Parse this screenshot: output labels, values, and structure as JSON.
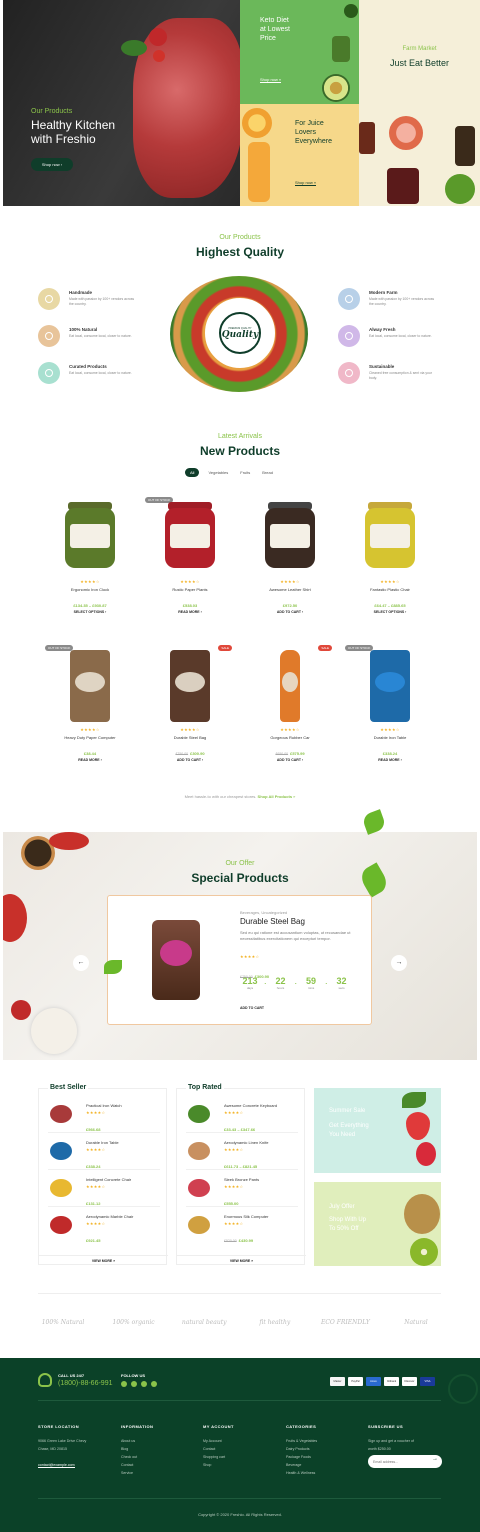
{
  "hero": {
    "main": {
      "kicker": "Our Products",
      "title_l1": "Healthy Kitchen",
      "title_l2": "with Freshio",
      "button": "Shop now"
    },
    "keto": {
      "l1": "Keto Diet",
      "l2": "at Lowest",
      "l3": "Price",
      "button": "Shop now"
    },
    "farm": {
      "kicker": "Farm Market",
      "title": "Just Eat Better"
    },
    "juice": {
      "l1": "For Juice",
      "l2": "Lovers",
      "l3": "Everywhere",
      "button": "Shop now"
    }
  },
  "quality": {
    "kicker": "Our Products",
    "title": "Highest Quality",
    "badge_top": "PREMIUM QUALITY",
    "badge_word": "Quality",
    "left": [
      {
        "title": "Handmade",
        "desc": "Made with passion by 100+ vendors across the country.",
        "icon": "hand-icon",
        "color": "#e8d8a4"
      },
      {
        "title": "100% Natural",
        "desc": "Eat local, consume local, closer to nature.",
        "icon": "leaf-icon",
        "color": "#e8c49a"
      },
      {
        "title": "Curated Products",
        "desc": "Eat local, consume local, closer to nature.",
        "icon": "basket-icon",
        "color": "#a8e0d0"
      }
    ],
    "right": [
      {
        "title": "Modern Farm",
        "desc": "Made with passion by 100+ vendors across the country.",
        "icon": "farm-icon",
        "color": "#b8d0e8"
      },
      {
        "title": "Alway Fresh",
        "desc": "Eat local, consume local, closer to nature.",
        "icon": "fresh-icon",
        "color": "#d0b8e8"
      },
      {
        "title": "Sustainable",
        "desc": "Cleaned free consumption & sent via your body.",
        "icon": "sustain-icon",
        "color": "#f0b8c8"
      }
    ]
  },
  "new_products": {
    "kicker": "Latest Arrivals",
    "title": "New Products",
    "filters": [
      "All",
      "Vegetables",
      "Fruits",
      "Bread"
    ],
    "row1": [
      {
        "name": "Ergonomic Iron Clock",
        "price": "£134.35 – £930.87",
        "old": "",
        "action": "SELECT OPTIONS",
        "badge": "",
        "jar": "#5b7a2a",
        "lid": "#5a6a2a",
        "label": "CORNICHONS"
      },
      {
        "name": "Rustic Paper Plants",
        "price": "£538.03",
        "old": "",
        "action": "READ MORE",
        "badge": "OUT OF STOCK",
        "jar": "#b3202a",
        "lid": "#a01d26",
        "label": "biona"
      },
      {
        "name": "Awesome Leather Shirt",
        "price": "£972.50",
        "old": "",
        "action": "ADD TO CART",
        "badge": "",
        "jar": "#3a2a22",
        "lid": "#444",
        "label": "BAKED GIANT BEANS"
      },
      {
        "name": "Fantastic Plastic Chair",
        "price": "£64.47 – £885.65",
        "old": "",
        "action": "SELECT OPTIONS",
        "badge": "",
        "jar": "#d6c430",
        "lid": "#c6a83a",
        "label": "LUPIN BEANS"
      }
    ],
    "row2": [
      {
        "name": "Heavy Duty Paper Computer",
        "price": "£38.44",
        "old": "",
        "action": "READ MORE",
        "badge": "OUT OF STOCK",
        "bag": "#8a6a4a",
        "label": "biona"
      },
      {
        "name": "Durable Steel Bag",
        "price": "£300.90",
        "old": "£750.00",
        "action": "ADD TO CART",
        "badge": "SALE",
        "bag": "#5a3a2a",
        "label": "LINSEED"
      },
      {
        "name": "Gorgeous Rubber Car",
        "price": "£575.99",
        "old": "£650.00",
        "action": "ADD TO CART",
        "badge": "SALE",
        "bag": "#e07a2a",
        "label": "biona"
      },
      {
        "name": "Durable Iron Table",
        "price": "£338.24",
        "old": "",
        "action": "READ MORE",
        "badge": "OUT OF STOCK",
        "bag": "#1e6aa8",
        "label": "PROTEIN"
      }
    ],
    "footer_text": "Meet hassle-to with our cheapest stores.",
    "footer_link": "Shop All Products"
  },
  "special": {
    "kicker": "Our Offer",
    "title": "Special Products",
    "category": "Beverages, Uncategorized",
    "name": "Durable Steel Bag",
    "desc": "Sed eu qui ratione est accusantium voluptas, ut recusandae ut necessitatibus exercitationem qui excepturi tempor.",
    "old": "£750.00",
    "price": "£300.90",
    "countdown": [
      {
        "v": "213",
        "l": "days"
      },
      {
        "v": "22",
        "l": "hours"
      },
      {
        "v": "59",
        "l": "mins"
      },
      {
        "v": "32",
        "l": "secs"
      }
    ],
    "action": "ADD TO CART"
  },
  "best_seller": {
    "title": "Best Seller",
    "items": [
      {
        "name": "Practical Iron Watch",
        "price": "£566.68",
        "old": "",
        "color": "#a83a3a"
      },
      {
        "name": "Durable Iron Table",
        "price": "£338.24",
        "old": "",
        "color": "#1e6aa8"
      },
      {
        "name": "Intelligent Concrete Chair",
        "price": "£131.12",
        "old": "",
        "color": "#e8b830"
      },
      {
        "name": "Aerodynamic Marble Chair",
        "price": "£921.45",
        "old": "",
        "color": "#c02a2a"
      }
    ],
    "view_more": "VIEW MORE"
  },
  "top_rated": {
    "title": "Top Rated",
    "items": [
      {
        "name": "Awesome Concrete Keyboard",
        "price": "£33.43 – £347.66",
        "old": "",
        "color": "#4a8a2a"
      },
      {
        "name": "Aerodynamic Linen Knife",
        "price": "£611.73 – £821.45",
        "old": "",
        "color": "#c89060"
      },
      {
        "name": "Sleek Bronze Pants",
        "price": "£555.00",
        "old": "",
        "color": "#d04050"
      },
      {
        "name": "Enormous Silk Computer",
        "price": "£430.99",
        "old": "£520.00",
        "color": "#d0a040"
      }
    ],
    "view_more": "VIEW MORE"
  },
  "promos": [
    {
      "kicker": "Summer Sale",
      "l1": "Get Everything",
      "l2": "You Need",
      "bg": "#cfeee6"
    },
    {
      "kicker": "July Offer",
      "l1": "Shop With Up",
      "l2": "To 50% Off",
      "bg": "#e0eebc"
    }
  ],
  "brands": [
    "100% Natural",
    "100% organic",
    "natural beauty",
    "fit healthy",
    "ECO FRIENDLY",
    "Natural"
  ],
  "footer": {
    "call_label": "CALL US 24/7",
    "phone": "(1800)-88-66-991",
    "follow_label": "FOLLOW US",
    "payments": [
      "Master",
      "PayPal",
      "Amex",
      "Citibank",
      "Discover",
      "VISA"
    ],
    "cols": [
      {
        "h": "STORE LOCATION",
        "links": [
          "9066 Green Lake Drive Chevy",
          "Chase, MD 20815"
        ],
        "extra": "contact@example.com"
      },
      {
        "h": "INFORMATION",
        "links": [
          "About us",
          "Blog",
          "Check out",
          "Contact",
          "Service"
        ]
      },
      {
        "h": "MY ACCOUNT",
        "links": [
          "My Account",
          "Contact",
          "Shopping cart",
          "Shop"
        ]
      },
      {
        "h": "CATEGORIES",
        "links": [
          "Fruits & Vegetables",
          "Dairy Products",
          "Package Foods",
          "Beverage",
          "Health & Wellness"
        ]
      },
      {
        "h": "SUBSCRIBE US",
        "links": [
          "Sign up and get a voucher of",
          "worth $250.00"
        ]
      }
    ],
    "email_placeholder": "Email address...",
    "copyright": "Copyright © 2020 Freshio. All Rights Reserved."
  },
  "colors": {
    "brand": "#0f3d2a",
    "accent": "#8bc34a",
    "footer": "#0b4128"
  }
}
